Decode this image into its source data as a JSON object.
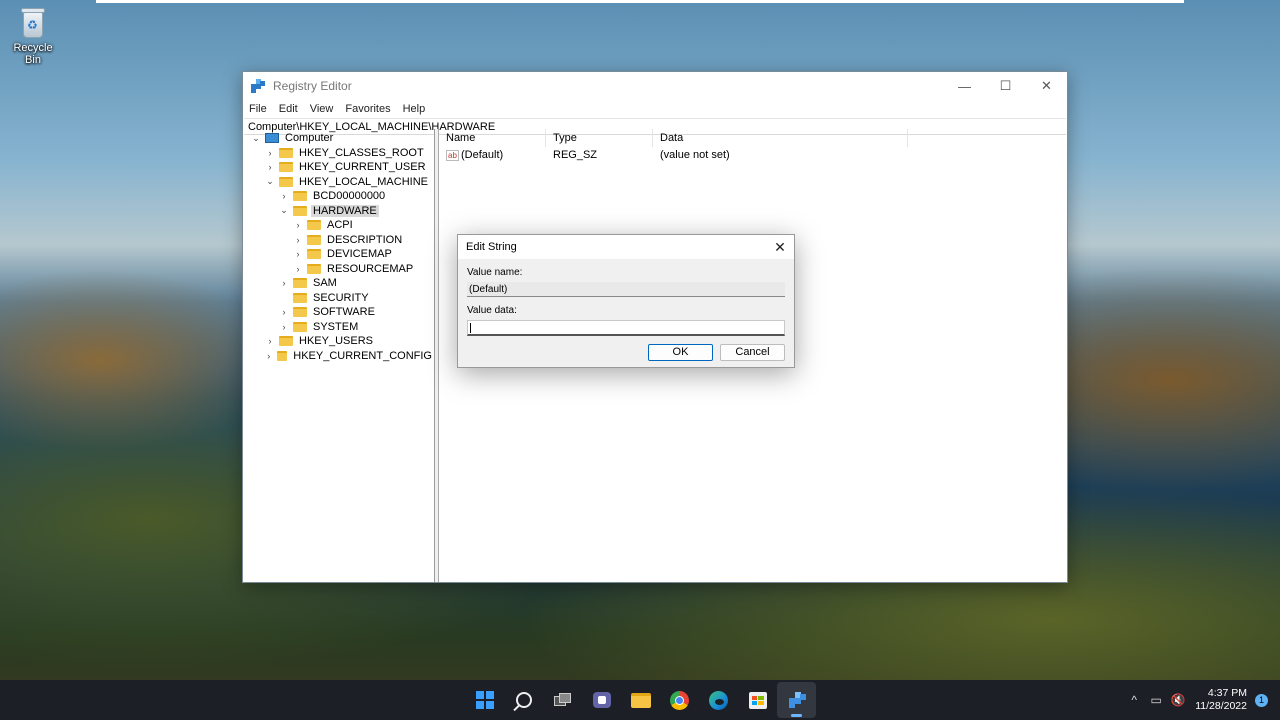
{
  "desktop": {
    "recycle_bin_label": "Recycle Bin"
  },
  "window": {
    "title": "Registry Editor",
    "controls": {
      "minimize": "—",
      "maximize": "☐",
      "close": "✕"
    },
    "menu": [
      "File",
      "Edit",
      "View",
      "Favorites",
      "Help"
    ],
    "address": "Computer\\HKEY_LOCAL_MACHINE\\HARDWARE",
    "tree": [
      {
        "label": "Computer",
        "level": 0,
        "expander": "expanded",
        "icon": "computer-icon"
      },
      {
        "label": "HKEY_CLASSES_ROOT",
        "level": 1,
        "expander": "collapsed",
        "icon": "folder-icon"
      },
      {
        "label": "HKEY_CURRENT_USER",
        "level": 1,
        "expander": "collapsed",
        "icon": "folder-icon"
      },
      {
        "label": "HKEY_LOCAL_MACHINE",
        "level": 1,
        "expander": "expanded",
        "icon": "folder-icon"
      },
      {
        "label": "BCD00000000",
        "level": 2,
        "expander": "collapsed",
        "icon": "folder-icon"
      },
      {
        "label": "HARDWARE",
        "level": 2,
        "expander": "expanded",
        "icon": "folder-icon",
        "selected": true
      },
      {
        "label": "ACPI",
        "level": 3,
        "expander": "collapsed",
        "icon": "folder-icon"
      },
      {
        "label": "DESCRIPTION",
        "level": 3,
        "expander": "collapsed",
        "icon": "folder-icon"
      },
      {
        "label": "DEVICEMAP",
        "level": 3,
        "expander": "collapsed",
        "icon": "folder-icon"
      },
      {
        "label": "RESOURCEMAP",
        "level": 3,
        "expander": "collapsed",
        "icon": "folder-icon"
      },
      {
        "label": "SAM",
        "level": 2,
        "expander": "collapsed",
        "icon": "folder-icon"
      },
      {
        "label": "SECURITY",
        "level": 2,
        "expander": "none",
        "icon": "folder-icon"
      },
      {
        "label": "SOFTWARE",
        "level": 2,
        "expander": "collapsed",
        "icon": "folder-icon"
      },
      {
        "label": "SYSTEM",
        "level": 2,
        "expander": "collapsed",
        "icon": "folder-icon"
      },
      {
        "label": "HKEY_USERS",
        "level": 1,
        "expander": "collapsed",
        "icon": "folder-icon"
      },
      {
        "label": "HKEY_CURRENT_CONFIG",
        "level": 1,
        "expander": "collapsed",
        "icon": "folder-icon"
      }
    ],
    "list": {
      "columns": [
        "Name",
        "Type",
        "Data"
      ],
      "rows": [
        {
          "icon": "string-value-icon",
          "icon_text": "ab",
          "name": "(Default)",
          "type": "REG_SZ",
          "data": "(value not set)"
        }
      ]
    }
  },
  "dialog": {
    "title": "Edit String",
    "close": "✕",
    "value_name_label": "Value name:",
    "value_name": "(Default)",
    "value_data_label": "Value data:",
    "value_data": "",
    "ok_label": "OK",
    "cancel_label": "Cancel"
  },
  "taskbar": {
    "apps": [
      "start-icon",
      "search-icon",
      "task-view-icon",
      "teams-chat-icon",
      "file-explorer-icon",
      "chrome-icon",
      "edge-icon",
      "store-icon",
      "registry-editor-icon"
    ],
    "active_app": "registry-editor-icon",
    "tray": {
      "chevron": "^",
      "network": "▭",
      "volume": "🔇",
      "time": "4:37 PM",
      "date": "11/28/2022",
      "notifications": "1"
    }
  },
  "colors": {
    "accent": "#0067c0",
    "selection": "#d9d9d9",
    "folder": "#f4c84a",
    "taskbar": "#1c1f26"
  }
}
